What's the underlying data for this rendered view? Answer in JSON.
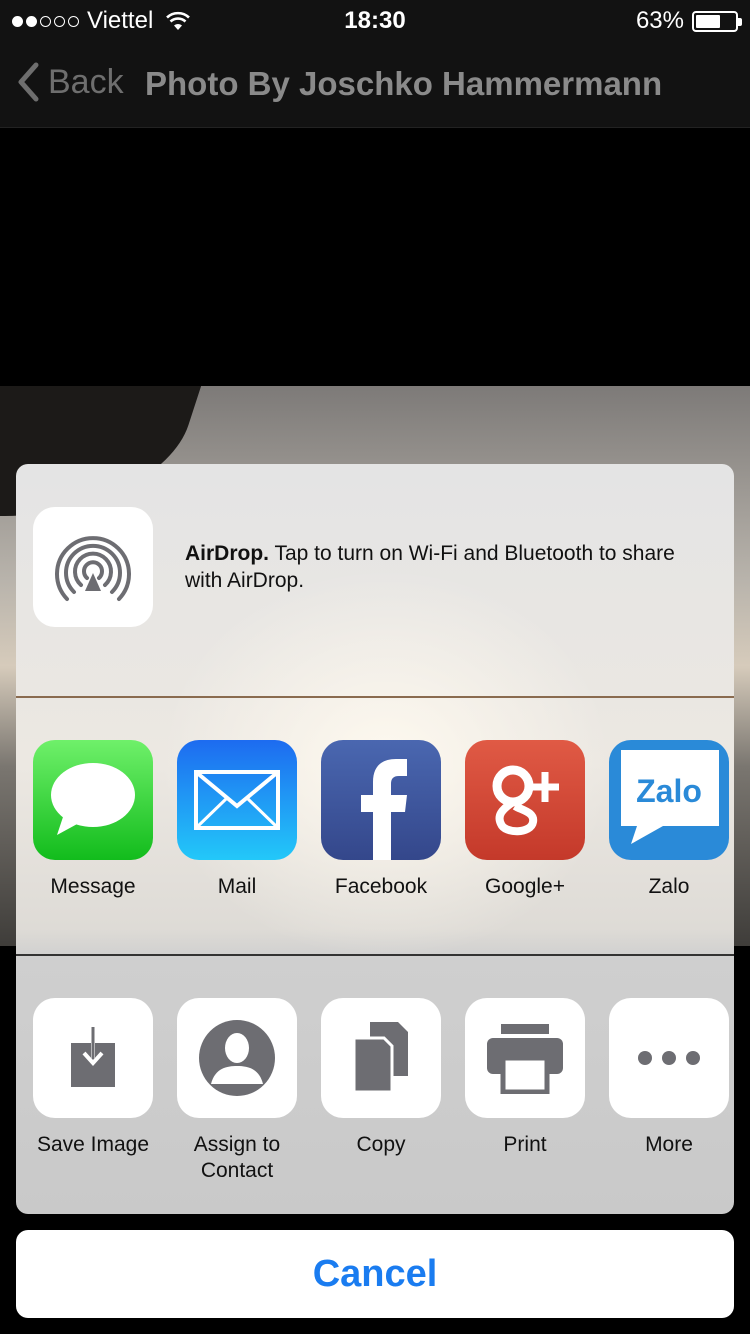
{
  "status_bar": {
    "carrier": "Viettel",
    "signal_bars_filled": 2,
    "signal_bars_total": 5,
    "time": "18:30",
    "battery_text": "63%",
    "battery_level": 0.63
  },
  "nav": {
    "back_label": "Back",
    "title": "Photo By Joschko Hammermann"
  },
  "share_sheet": {
    "airdrop": {
      "title": "AirDrop.",
      "message": " Tap to turn on Wi-Fi and Bluetooth to share with AirDrop."
    },
    "apps": [
      {
        "label": "Message",
        "icon": "messages-icon"
      },
      {
        "label": "Mail",
        "icon": "mail-icon"
      },
      {
        "label": "Facebook",
        "icon": "facebook-icon"
      },
      {
        "label": "Google+",
        "icon": "google-plus-icon"
      },
      {
        "label": "Zalo",
        "icon": "zalo-icon",
        "icon_text": "Zalo"
      }
    ],
    "actions": [
      {
        "label": "Save Image",
        "icon": "save-image-icon"
      },
      {
        "label": "Assign to\nContact",
        "icon": "contact-icon"
      },
      {
        "label": "Copy",
        "icon": "copy-icon"
      },
      {
        "label": "Print",
        "icon": "printer-icon"
      },
      {
        "label": "More",
        "icon": "more-icon"
      }
    ],
    "cancel_label": "Cancel"
  },
  "colors": {
    "accent": "#1a7cf0",
    "bar_background": "#121212"
  }
}
